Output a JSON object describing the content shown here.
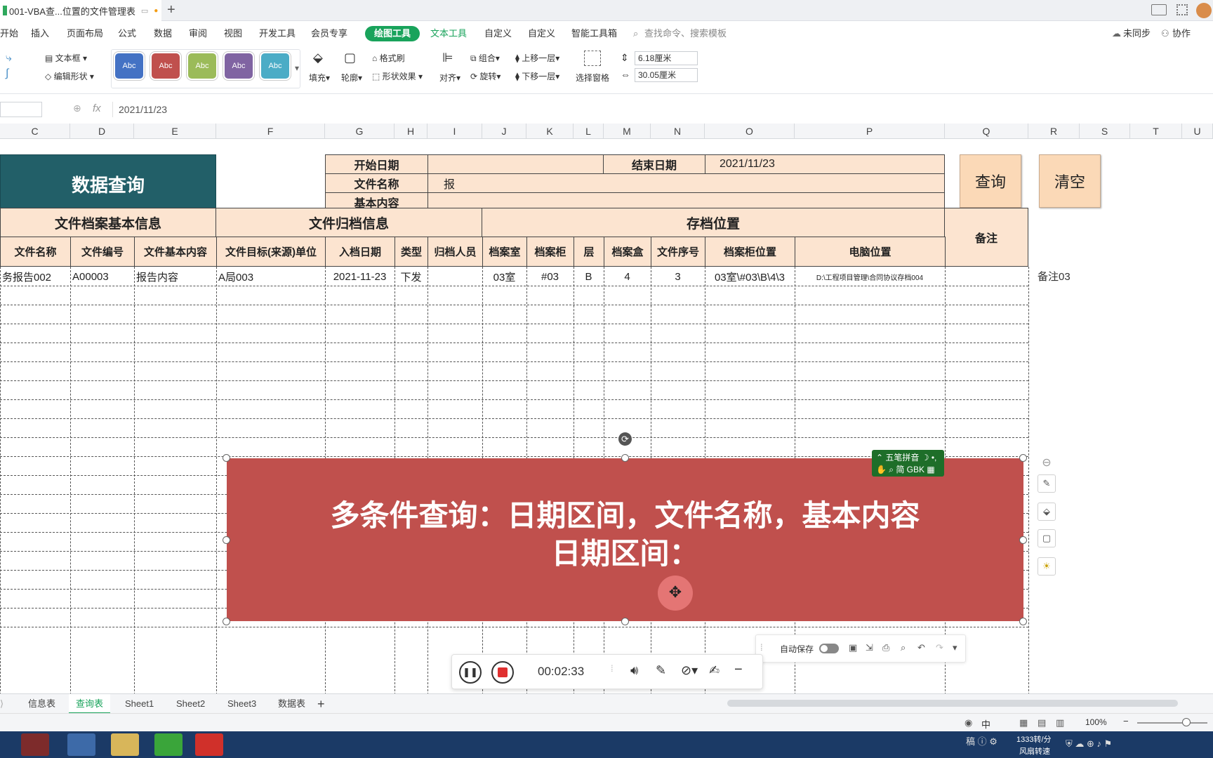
{
  "titlebar": {
    "doc_title": "001-VBA查...位置的文件管理表",
    "new_tab": "+"
  },
  "menu": {
    "items": [
      "开始",
      "插入",
      "页面布局",
      "公式",
      "数据",
      "审阅",
      "视图",
      "开发工具",
      "会员专享"
    ],
    "active_pill": "绘图工具",
    "text_tools": "文本工具",
    "custom1": "自定义",
    "custom2": "自定义",
    "smart": "智能工具箱",
    "search": "查找命令、搜索模板",
    "sync": "未同步",
    "collab": "协作"
  },
  "ribbon": {
    "textbox": "文本框",
    "edit_shape": "编辑形状",
    "swatch_label": "Abc",
    "fill": "填充",
    "outline": "轮廓",
    "format_brush": "格式刷",
    "shape_effect": "形状效果",
    "align": "对齐",
    "group": "组合",
    "rotate": "旋转",
    "up_layer": "上移一层",
    "down_layer": "下移一层",
    "selection_pane": "选择窗格",
    "height": "6.18厘米",
    "width": "30.05厘米",
    "colors": [
      "#4472c4",
      "#c0504d",
      "#9bbb59",
      "#8064a2",
      "#4bacc6"
    ]
  },
  "formula": {
    "fx": "fx",
    "value": "2021/11/23"
  },
  "columns": [
    "C",
    "D",
    "E",
    "F",
    "G",
    "H",
    "I",
    "J",
    "K",
    "L",
    "M",
    "N",
    "O",
    "P",
    "Q",
    "R",
    "S",
    "T",
    "U"
  ],
  "query": {
    "title": "数据查询",
    "start_label": "开始日期",
    "start_value": "",
    "end_label": "结束日期",
    "end_value": "2021/11/23",
    "name_label": "文件名称",
    "name_value": "报",
    "content_label": "基本内容",
    "content_value": "",
    "btn_query": "查询",
    "btn_clear": "清空"
  },
  "table": {
    "group1": "文件档案基本信息",
    "group2": "文件归档信息",
    "group3": "存档位置",
    "remark": "备注",
    "headers": [
      "文件名称",
      "文件编号",
      "文件基本内容",
      "文件目标(来源)单位",
      "入档日期",
      "类型",
      "归档人员",
      "档案室",
      "档案柜",
      "层",
      "档案盒",
      "文件序号",
      "档案柜位置",
      "电脑位置"
    ],
    "row": [
      "务报告002",
      "A00003",
      "报告内容",
      "A局003",
      "2021-11-23",
      "下发",
      "",
      "03室",
      "#03",
      "B",
      "4",
      "3",
      "03室\\#03\\B\\4\\3",
      "D:\\工程项目管理\\合同协议存档004",
      ""
    ],
    "side_note": "备注03"
  },
  "overlay": {
    "line1": "多条件查询：日期区间，文件名称，基本内容",
    "line2": "日期区间："
  },
  "ime": {
    "name": "五笔拼音",
    "mode": "简 GBK"
  },
  "recorder": {
    "time": "00:02:33"
  },
  "quick": {
    "autosave": "自动保存"
  },
  "sheets": {
    "tabs": [
      "信息表",
      "查询表",
      "Sheet1",
      "Sheet2",
      "Sheet3",
      "数据表"
    ],
    "active": "查询表",
    "add": "+"
  },
  "status": {
    "zoom": "100%",
    "lang": "中"
  },
  "taskbar": {
    "net_speed": "1333转/分",
    "net_label": "风扇转速"
  }
}
